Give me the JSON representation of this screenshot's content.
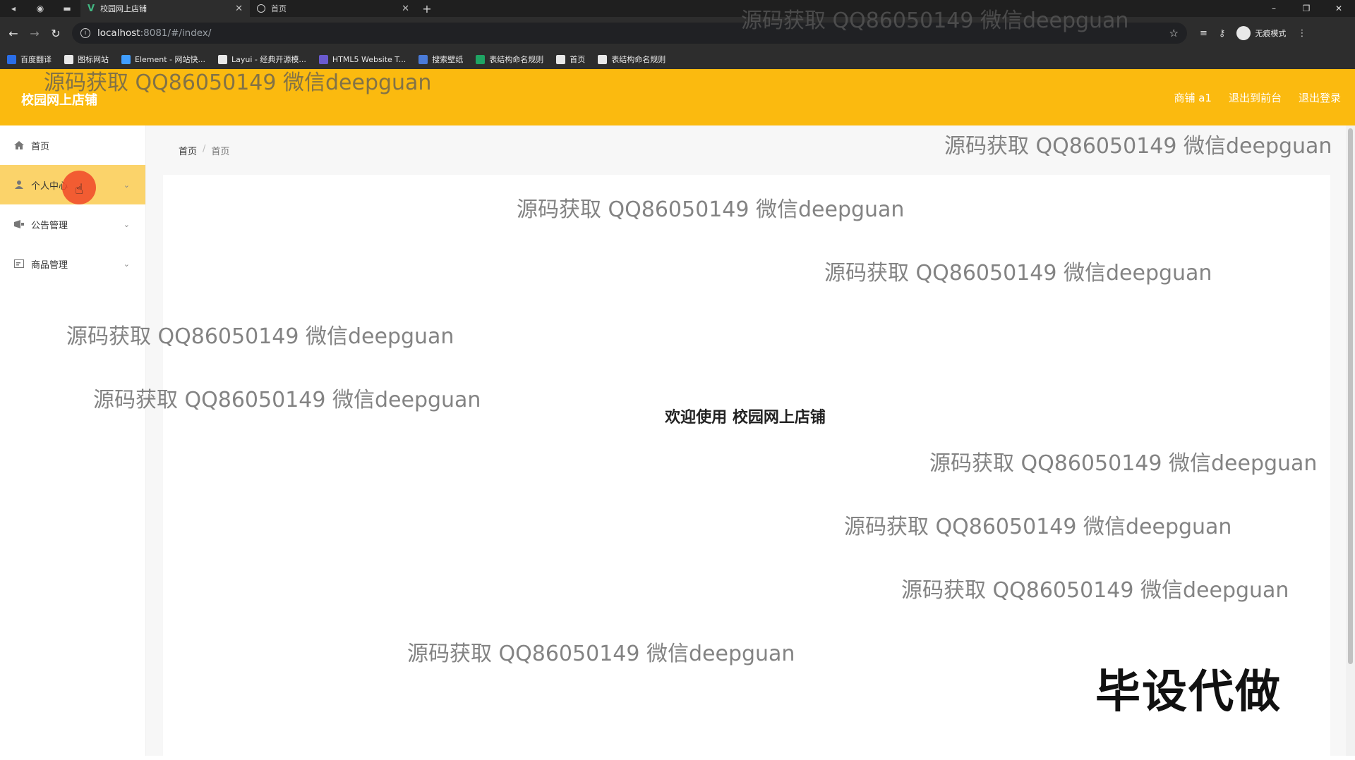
{
  "browser": {
    "tabs": [
      {
        "title": "校园网上店铺",
        "active": true
      },
      {
        "title": "首页",
        "active": false
      }
    ],
    "url_host": "localhost",
    "url_path": ":8081/#/index/",
    "incognito_label": "无痕模式",
    "bookmarks": [
      {
        "label": "百度翻译",
        "color": "#2a6ee8"
      },
      {
        "label": "图标网站",
        "color": "#e8e8e8"
      },
      {
        "label": "Element - 网站快...",
        "color": "#409eff"
      },
      {
        "label": "Layui - 经典开源模...",
        "color": "#e8e8e8"
      },
      {
        "label": "HTML5 Website T...",
        "color": "#6a5acd"
      },
      {
        "label": "搜索壁纸",
        "color": "#4a7bd8"
      },
      {
        "label": "表结构命名规则",
        "color": "#1fa463"
      },
      {
        "label": "首页",
        "color": "#e8e8e8"
      },
      {
        "label": "表结构命名规则",
        "color": "#e8e8e8"
      }
    ]
  },
  "header": {
    "title": "校园网上店铺",
    "links": [
      "商铺 a1",
      "退出到前台",
      "退出登录"
    ],
    "color": "#fbba0f"
  },
  "sidebar": {
    "items": [
      {
        "label": "首页",
        "icon": "home-icon",
        "has_submenu": false
      },
      {
        "label": "个人中心",
        "icon": "user-icon",
        "has_submenu": true,
        "active": true
      },
      {
        "label": "公告管理",
        "icon": "notice-icon",
        "has_submenu": true
      },
      {
        "label": "商品管理",
        "icon": "goods-icon",
        "has_submenu": true
      }
    ]
  },
  "breadcrumb": {
    "root": "首页",
    "separator": "/",
    "current": "首页"
  },
  "main": {
    "welcome": "欢迎使用 校园网上店铺"
  },
  "watermark": {
    "text": "源码获取 QQ86050149 微信deepguan"
  },
  "stamp": "毕设代做"
}
